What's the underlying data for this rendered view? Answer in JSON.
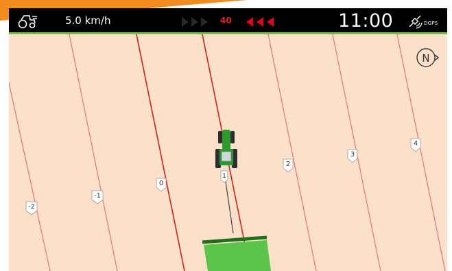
{
  "status_bar": {
    "tractor_icon": "tractor-icon",
    "speed": "5.0 km/h",
    "steering_indicator": {
      "left_icon": "triple-chevron-right-icon",
      "left_state": "inactive",
      "offset": "40",
      "right_icon": "triple-chevron-left-icon",
      "right_state": "active"
    },
    "time": "11:00",
    "satellite_icon": "satellite-icon",
    "gps_mode": "DGPS"
  },
  "map": {
    "background_color": "#fbe1c9",
    "guidance_line_color": "#e57373",
    "active_line_color": "#d81e1e",
    "compass_label": "N",
    "track_lines": [
      {
        "label": "-2",
        "active": false
      },
      {
        "label": "-1",
        "active": false
      },
      {
        "label": "0",
        "active": true
      },
      {
        "label": "1",
        "active": true
      },
      {
        "label": "2",
        "active": false
      },
      {
        "label": "3",
        "active": false
      },
      {
        "label": "4",
        "active": false
      }
    ],
    "vehicle_icon": "tractor-topview-icon",
    "implement_icon": "implement-icon",
    "worked_area_color": "#5cc44a"
  },
  "colors": {
    "accent": "#f28c1e",
    "status_green": "#6fbf3a",
    "vehicle_green": "#2d9a2d"
  }
}
